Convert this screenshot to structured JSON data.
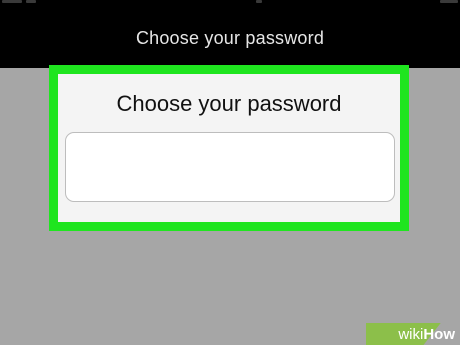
{
  "header": {
    "title": "Choose your password"
  },
  "dialog": {
    "title": "Choose your password",
    "password_input": {
      "value": "",
      "placeholder": ""
    }
  },
  "watermark": {
    "wiki": "wiki",
    "how": "How"
  },
  "colors": {
    "highlight_border": "#1fe51f",
    "header_background": "#000000",
    "backdrop": "#a6a6a6",
    "dialog_background": "#f4f4f4"
  }
}
